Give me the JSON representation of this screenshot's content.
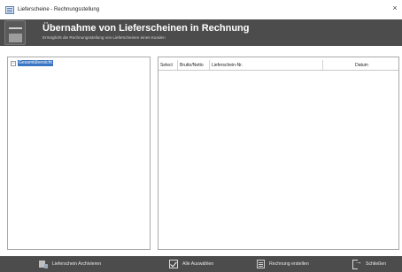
{
  "window": {
    "title": "Lieferscheine - Rechnungsstellung",
    "close_glyph": "×"
  },
  "header": {
    "title": "Übernahme von Lieferscheinen in Rechnung",
    "subtitle": "Ermöglicht die Rechnungsstellung von Lieferscheinen eines Kunden",
    "icon": "document-list-icon"
  },
  "tree": {
    "toggle_glyph": "−",
    "nodes": [
      {
        "label": "Gesamtübersicht",
        "selected": true
      }
    ]
  },
  "list": {
    "columns": [
      "Select",
      "Brutto/Netto",
      "Lieferschein-Nr.",
      "Datum"
    ],
    "rows": []
  },
  "toolbar": {
    "buttons": [
      {
        "label": "Lieferschein Archivieren",
        "icon": "archive-icon"
      },
      {
        "label": "Alle Auswählen",
        "icon": "checkbox-icon"
      },
      {
        "label": "Rechnung erstellen",
        "icon": "invoice-icon"
      },
      {
        "label": "Schließen",
        "icon": "exit-icon"
      }
    ]
  },
  "colors": {
    "header_bg": "#4c4c4c",
    "selection": "#3a75c4"
  }
}
